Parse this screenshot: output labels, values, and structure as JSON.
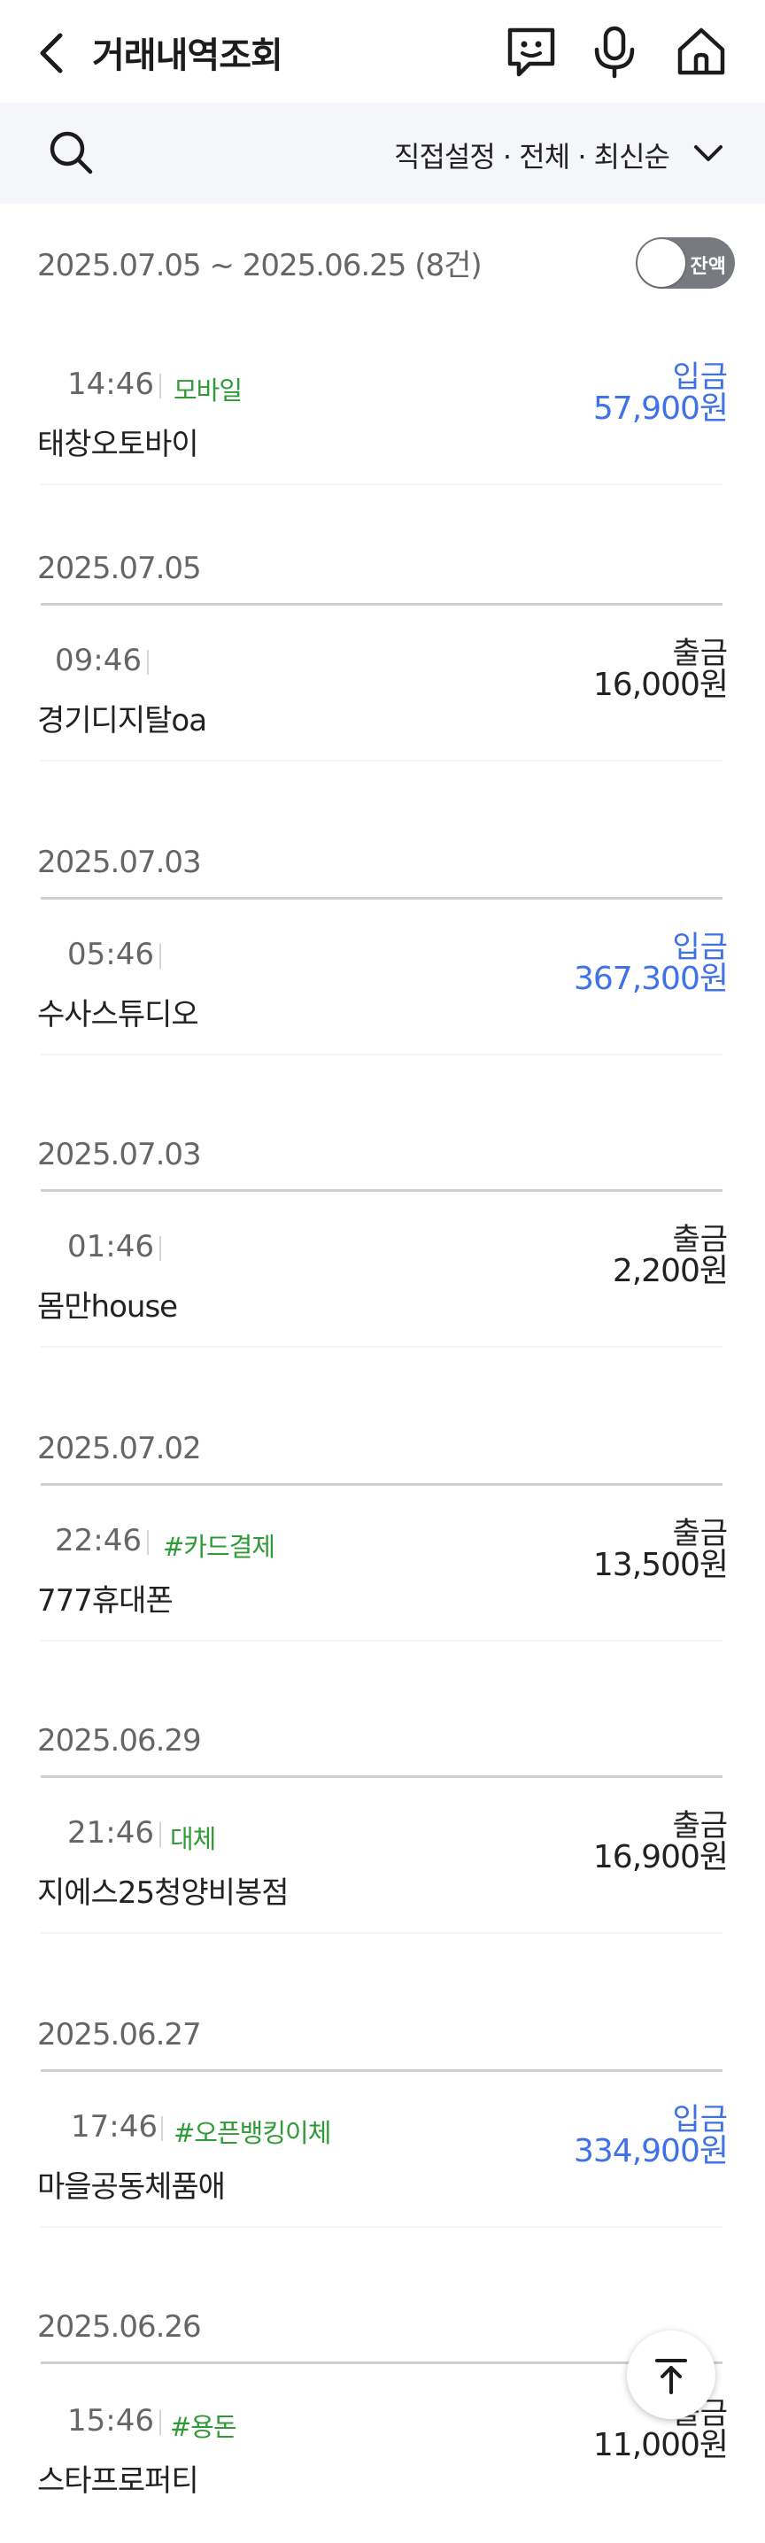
{
  "header": {
    "title": "거래내역조회",
    "icons": [
      "back-arrow-icon",
      "chat-bot-icon",
      "microphone-icon",
      "home-icon"
    ]
  },
  "filter": {
    "summary": "직접설정 · 전체 · 최신순",
    "icons": [
      "search-icon",
      "chevron-down-icon"
    ]
  },
  "period": {
    "text": "2025.07.05 ~ 2025.06.25 (8건)",
    "balance_toggle_label": "잔액",
    "balance_toggle_on": false
  },
  "colors": {
    "deposit": "#3f72e6",
    "withdrawal": "#222222",
    "tag": "#2f9b37",
    "toggle_off": "#777b80",
    "filter_bg": "#f4f6fa"
  },
  "groups": [
    {
      "date": "",
      "tx": {
        "time": "14:46",
        "tag": "모바일",
        "name": "태창오토바이",
        "type": "입금",
        "amount": "57,900원",
        "kind": "in"
      }
    },
    {
      "date": "2025.07.05",
      "tx": {
        "time": "09:46",
        "tag": "",
        "name": "경기디지탈oa",
        "type": "출금",
        "amount": "16,000원",
        "kind": "out"
      }
    },
    {
      "date": "2025.07.03",
      "tx": {
        "time": "05:46",
        "tag": "",
        "name": "수사스튜디오",
        "type": "입금",
        "amount": "367,300원",
        "kind": "in"
      }
    },
    {
      "date": "2025.07.03",
      "tx": {
        "time": "01:46",
        "tag": "",
        "name": "몸만house",
        "type": "출금",
        "amount": "2,200원",
        "kind": "out"
      }
    },
    {
      "date": "2025.07.02",
      "tx": {
        "time": "22:46",
        "tag": "#카드결제",
        "name": "777휴대폰",
        "type": "출금",
        "amount": "13,500원",
        "kind": "out"
      }
    },
    {
      "date": "2025.06.29",
      "tx": {
        "time": "21:46",
        "tag": "대체",
        "name": "지에스25청양비봉점",
        "type": "출금",
        "amount": "16,900원",
        "kind": "out"
      }
    },
    {
      "date": "2025.06.27",
      "tx": {
        "time": "17:46",
        "tag": "#오픈뱅킹이체",
        "name": "마을공동체품애",
        "type": "입금",
        "amount": "334,900원",
        "kind": "in"
      }
    },
    {
      "date": "2025.06.26",
      "tx": {
        "time": "15:46",
        "tag": "#용돈",
        "name": "스타프로퍼티",
        "type": "출금",
        "amount": "11,000원",
        "kind": "out"
      }
    }
  ],
  "scroll_top_icon": "arrow-up-icon"
}
